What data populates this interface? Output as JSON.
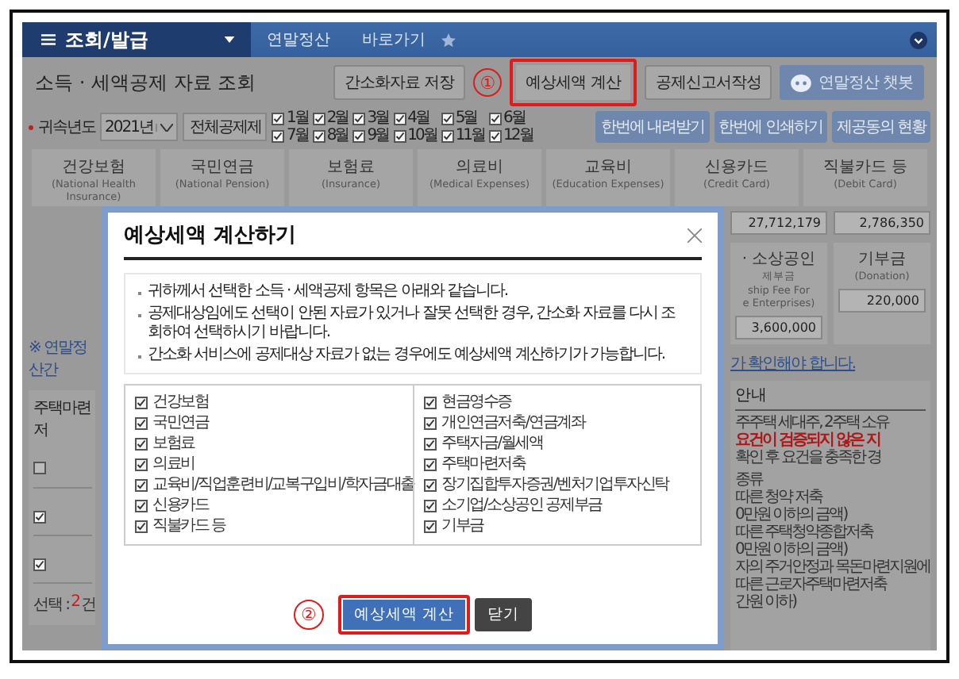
{
  "nav": {
    "menu_label": "조회/발급",
    "crumbs": [
      "연말정산",
      "바로가기"
    ]
  },
  "header": {
    "title": "소득 · 세액공제 자료 조회",
    "buttons": [
      {
        "label": "간소화자료 저장",
        "highlighted": false,
        "kind": "plain"
      },
      {
        "label": "예상세액 계산",
        "highlighted": true,
        "kind": "plain"
      },
      {
        "label": "공제신고서작성",
        "highlighted": false,
        "kind": "plain"
      },
      {
        "label": "연말정산 챗봇",
        "highlighted": false,
        "kind": "bot"
      }
    ],
    "annotation": "①"
  },
  "year_row": {
    "label": "귀속년도",
    "year": "2021년",
    "clear_button": "전체공제제",
    "months": [
      {
        "label": "1월",
        "checked": true
      },
      {
        "label": "2월",
        "checked": true
      },
      {
        "label": "3월",
        "checked": true
      },
      {
        "label": "4월",
        "checked": true
      },
      {
        "label": "5월",
        "checked": true
      },
      {
        "label": "6월",
        "checked": true
      },
      {
        "label": "7월",
        "checked": true
      },
      {
        "label": "8월",
        "checked": true
      },
      {
        "label": "9월",
        "checked": true
      },
      {
        "label": "10월",
        "checked": true
      },
      {
        "label": "11월",
        "checked": true
      },
      {
        "label": "12월",
        "checked": true
      }
    ],
    "actions": [
      "한번에 내려받기",
      "한번에 인쇄하기",
      "제공동의 현황"
    ]
  },
  "cards": [
    {
      "title": "건강보험",
      "subtitle": "(National Health Insurance)"
    },
    {
      "title": "국민연금",
      "subtitle": "(National Pension)"
    },
    {
      "title": "보험료",
      "subtitle": "(Insurance)"
    },
    {
      "title": "의료비",
      "subtitle": "(Medical Expenses)"
    },
    {
      "title": "교육비",
      "subtitle": "(Education Expenses)"
    },
    {
      "title": "신용카드",
      "subtitle": "(Credit Card)"
    },
    {
      "title": "직불카드 등",
      "subtitle": "(Debit Card)"
    }
  ],
  "left_strip": {
    "link": "※ 연말정산간",
    "panel_title": "주택마련저",
    "rows": [
      {
        "checked": false
      },
      {
        "checked": true
      },
      {
        "checked": true
      }
    ],
    "selection": {
      "label": "선택 :",
      "count": "2",
      "unit": "건"
    }
  },
  "right_strip": {
    "values": [
      "27,712,179",
      "2,786,350"
    ],
    "cards": [
      {
        "lines": [
          "· 소상공인",
          "제부금",
          "ship Fee For",
          "e Enterprises)"
        ],
        "value": "3,600,000"
      },
      {
        "lines": [
          "기부금",
          "(Donation)"
        ],
        "value": "220,000"
      }
    ],
    "notice": "가 확인해야 합니다.",
    "panel_title": "안내",
    "lines": [
      {
        "text": "주주택 세대주, 2주택 소유",
        "kind": "plain"
      },
      {
        "text": "요건이 검증되지 않은 지",
        "kind": "warning"
      },
      {
        "text": "확인 후 요건을 충족한 경",
        "kind": "plain"
      },
      {
        "text": "종류",
        "kind": "heading"
      },
      {
        "text": "따른 청약 저축",
        "kind": "plain"
      },
      {
        "text": "0만원 이하의 금액)",
        "kind": "plain"
      },
      {
        "text": "따른 주택청약종합저축",
        "kind": "plain"
      },
      {
        "text": "0만원 이하의 금액)",
        "kind": "plain"
      },
      {
        "text": "자의 주거안정과 목돈마련지원에",
        "kind": "plain"
      },
      {
        "text": "따른 근로자주택마련저축",
        "kind": "plain"
      },
      {
        "text": "간원 이하)",
        "kind": "plain"
      }
    ]
  },
  "dialog": {
    "title": "예상세액 계산하기",
    "notes": [
      "귀하께서 선택한 소득 · 세액공제 항목은 아래와 같습니다.",
      "공제대상임에도 선택이 안된 자료가 있거나 잘못 선택한 경우, 간소화 자료를 다시 조회하여 선택하시기 바랍니다.",
      "간소화 서비스에 공제대상 자료가 없는 경우에도 예상세액 계산하기가 가능합니다."
    ],
    "columns": [
      [
        {
          "label": "건강보험",
          "checked": true
        },
        {
          "label": "국민연금",
          "checked": true
        },
        {
          "label": "보험료",
          "checked": true
        },
        {
          "label": "의료비",
          "checked": true
        },
        {
          "label": "교육비/직업훈련비/교복구입비/학자금대출",
          "checked": true
        },
        {
          "label": "신용카드",
          "checked": true
        },
        {
          "label": "직불카드 등",
          "checked": true
        }
      ],
      [
        {
          "label": "현금영수증",
          "checked": true
        },
        {
          "label": "개인연금저축/연금계좌",
          "checked": true
        },
        {
          "label": "주택자금/월세액",
          "checked": true
        },
        {
          "label": "주택마련저축",
          "checked": true
        },
        {
          "label": "장기집합투자증권/벤처기업투자신탁",
          "checked": true
        },
        {
          "label": "소기업/소상공인 공제부금",
          "checked": true
        },
        {
          "label": "기부금",
          "checked": true
        }
      ]
    ],
    "annotation": "②",
    "buttons": [
      {
        "label": "예상세액 계산",
        "kind": "primary",
        "highlighted": true
      },
      {
        "label": "닫기",
        "kind": "dark",
        "highlighted": false
      }
    ]
  }
}
